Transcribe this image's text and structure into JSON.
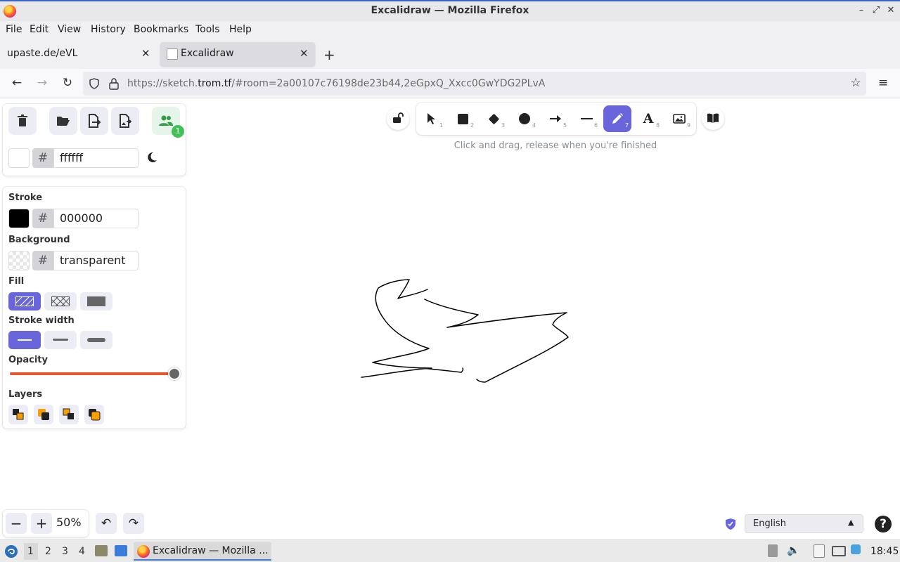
{
  "window": {
    "title": "Excalidraw — Mozilla Firefox"
  },
  "menu": [
    "File",
    "Edit",
    "View",
    "History",
    "Bookmarks",
    "Tools",
    "Help"
  ],
  "tabs": [
    {
      "label": "upaste.de/eVL",
      "active": false
    },
    {
      "label": "Excalidraw",
      "active": true
    }
  ],
  "nav": {
    "url_prefix": "https://sketch.",
    "url_host": "trom.tf",
    "url_rest": "/#room=2a00107c76198de23b44,2eGpxQ_Xxcc0GwYDG2PLvA"
  },
  "canvas_panel": {
    "bg_hash": "#",
    "bg_value": "ffffff",
    "collab_count": "1"
  },
  "props_panel": {
    "stroke_label": "Stroke",
    "stroke_hash": "#",
    "stroke_value": "000000",
    "stroke_color": "#000000",
    "background_label": "Background",
    "background_hash": "#",
    "background_value": "transparent",
    "fill_label": "Fill",
    "stroke_width_label": "Stroke width",
    "opacity_label": "Opacity",
    "opacity_percent": 100,
    "layers_label": "Layers"
  },
  "toolbar": {
    "tools": [
      {
        "name": "selection",
        "key": "1"
      },
      {
        "name": "rectangle",
        "key": "2"
      },
      {
        "name": "diamond",
        "key": "3"
      },
      {
        "name": "ellipse",
        "key": "4"
      },
      {
        "name": "arrow",
        "key": "5"
      },
      {
        "name": "line",
        "key": "6"
      },
      {
        "name": "draw",
        "key": "7",
        "selected": true
      },
      {
        "name": "text",
        "key": "8"
      },
      {
        "name": "image",
        "key": "9"
      }
    ],
    "hint": "Click and drag, release when you're finished"
  },
  "footer": {
    "zoom": "50%",
    "language": "English",
    "help": "?"
  },
  "taskbar": {
    "workspaces": [
      "1",
      "2",
      "3",
      "4"
    ],
    "active_window": "Excalidraw — Mozilla ...",
    "time": "18:45"
  },
  "colors": {
    "accent": "#6965db",
    "opacity_track": "#e8562a"
  }
}
